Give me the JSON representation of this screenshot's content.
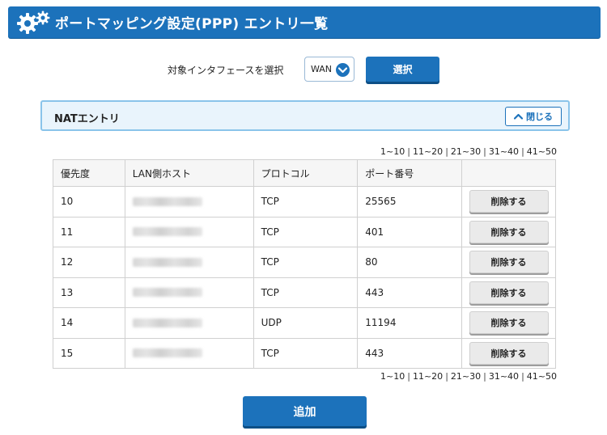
{
  "header": {
    "title": "ポートマッピング設定(PPP) エントリ一覧",
    "icon": "gears-icon"
  },
  "selector": {
    "label": "対象インタフェースを選択",
    "value": "WAN",
    "button_label": "選択"
  },
  "nat_panel": {
    "title": "NATエントリ",
    "close_label": "閉じる"
  },
  "pagination": [
    "1~10",
    "11~20",
    "21~30",
    "31~40",
    "41~50"
  ],
  "table": {
    "columns": [
      "優先度",
      "LAN側ホスト",
      "プロトコル",
      "ポート番号",
      ""
    ],
    "rows": [
      {
        "priority": "10",
        "protocol": "TCP",
        "port": "25565",
        "action": "削除する"
      },
      {
        "priority": "11",
        "protocol": "TCP",
        "port": "401",
        "action": "削除する"
      },
      {
        "priority": "12",
        "protocol": "TCP",
        "port": "80",
        "action": "削除する"
      },
      {
        "priority": "13",
        "protocol": "TCP",
        "port": "443",
        "action": "削除する"
      },
      {
        "priority": "14",
        "protocol": "UDP",
        "port": "11194",
        "action": "削除する"
      },
      {
        "priority": "15",
        "protocol": "TCP",
        "port": "443",
        "action": "削除する"
      }
    ]
  },
  "add_button": "追加",
  "colors": {
    "primary": "#1c72bb",
    "panel_bg": "#e9f4fc",
    "panel_border": "#8ac4ea"
  }
}
